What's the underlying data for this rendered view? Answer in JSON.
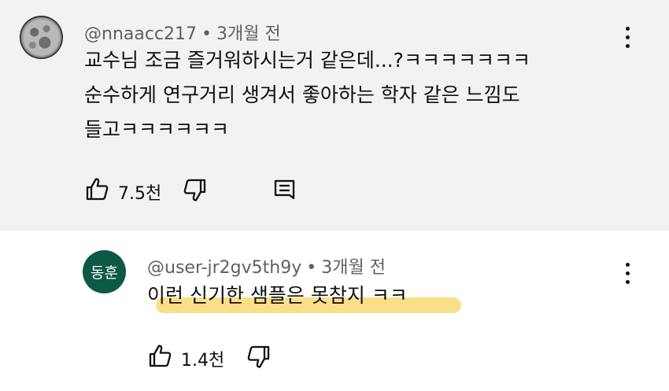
{
  "comments": [
    {
      "author": "@nnaacc217",
      "time": "3개월 전",
      "separator": "•",
      "text": "교수님 조금 즐거워하시는거 같은데...?ㅋㅋㅋㅋㅋㅋㅋ\n순수하게 연구거리 생겨서 좋아하는 학자 같은 느낌도\n들고ㅋㅋㅋㅋㅋㅋ",
      "likes": "7.5천",
      "background": "#f2f2f2"
    },
    {
      "author": "@user-jr2gv5th9y",
      "time": "3개월 전",
      "separator": "•",
      "avatar_text": "동훈",
      "avatar_color": "#0c5a45",
      "text": "이런 신기한 샘플은 못참지 ㅋㅋ",
      "highlight_color": "#f7d667",
      "likes": "1.4천",
      "background": "#ffffff"
    }
  ],
  "icons": {
    "avatar": "moon-avatar",
    "more": "more-vert-icon",
    "like": "thumb-up-icon",
    "dislike": "thumb-down-icon",
    "reply": "reply-comment-icon"
  }
}
